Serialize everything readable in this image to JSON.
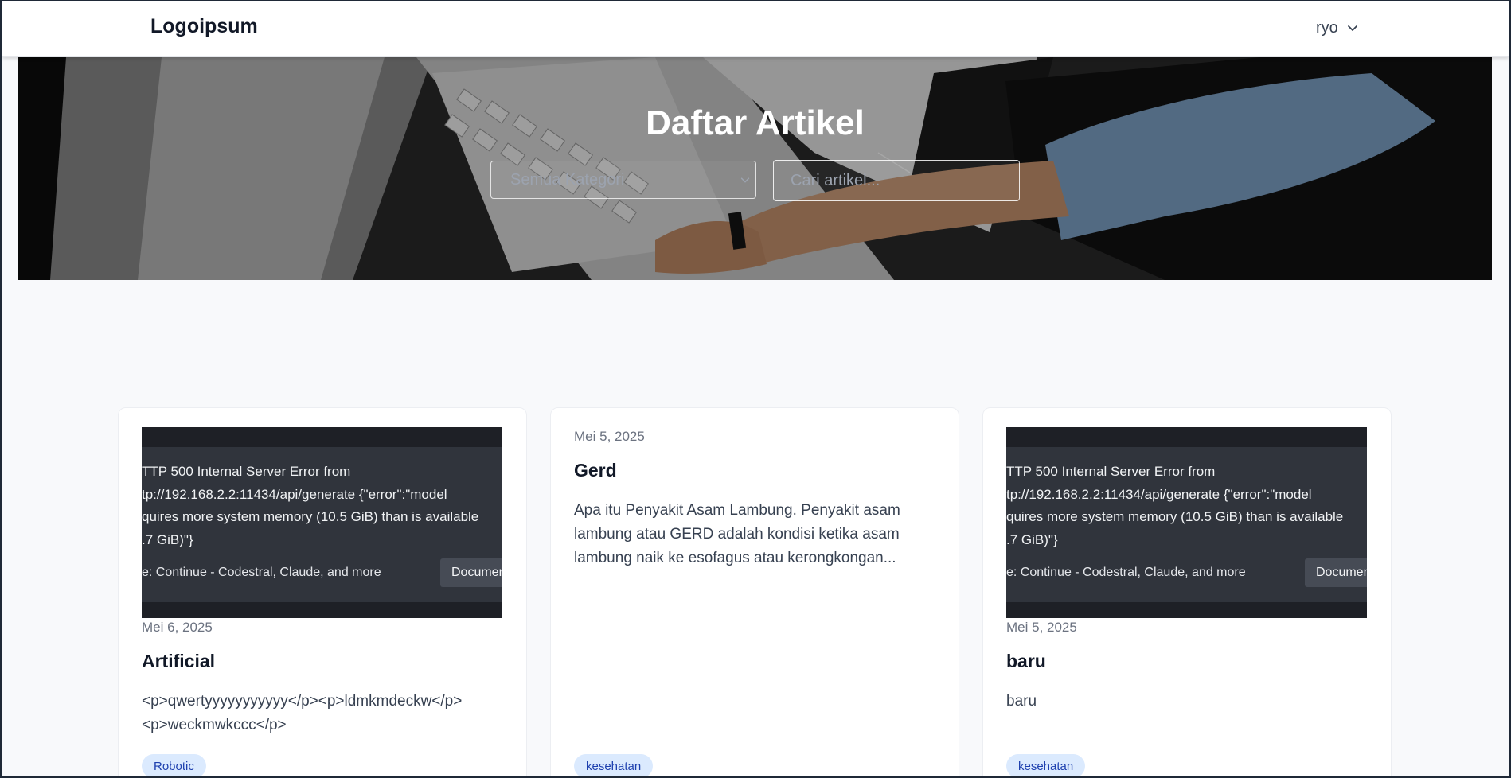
{
  "navbar": {
    "logo": "Logoipsum",
    "user": "ryo"
  },
  "hero": {
    "title": "Daftar Artikel",
    "category_select": "Semua Kategori",
    "search_placeholder": "Cari artikel..."
  },
  "articles": [
    {
      "thumbnail": {
        "lines": [
          "TTP 500 Internal Server Error from",
          "tp://192.168.2.2:11434/api/generate {\"error\":\"model",
          "quires more system memory (10.5 GiB) than is available",
          ".7 GiB)\"}"
        ],
        "source": "e: Continue - Codestral, Claude, and more",
        "button": "Documentation"
      },
      "date": "Mei 6, 2025",
      "title": "Artificial",
      "excerpt": "<p>qwertyyyyyyyyyyy</p><p>ldmkmdeckw</p><p>weckmwkccc</p>",
      "tag": "Robotic"
    },
    {
      "date": "Mei 5, 2025",
      "title": "Gerd",
      "excerpt": "Apa itu Penyakit Asam Lambung. Penyakit asam lambung atau GERD adalah kondisi ketika asam lambung naik ke esofagus atau kerongkongan...",
      "tag": "kesehatan"
    },
    {
      "thumbnail": {
        "lines": [
          "TTP 500 Internal Server Error from",
          "tp://192.168.2.2:11434/api/generate {\"error\":\"model",
          "quires more system memory (10.5 GiB) than is available",
          ".7 GiB)\"}"
        ],
        "source": "e: Continue - Codestral, Claude, and more",
        "button": "Documentation"
      },
      "date": "Mei 5, 2025",
      "title": "baru",
      "excerpt": "baru",
      "tag": "kesehatan"
    }
  ],
  "colors": {
    "background": "#f8f9fb",
    "tag_bg": "#dbeafe",
    "tag_text": "#1e40af",
    "thumbnail_bg": "#30343c"
  }
}
